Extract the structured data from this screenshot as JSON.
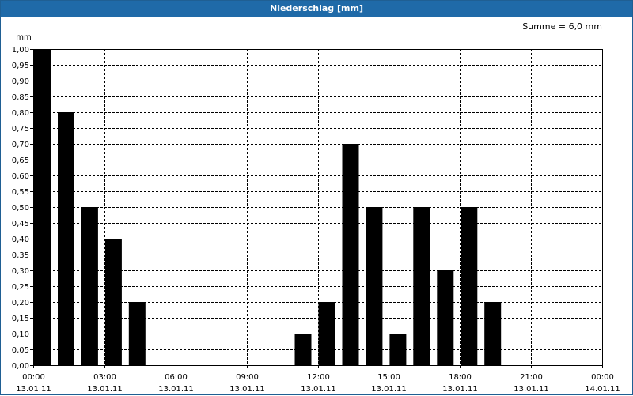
{
  "window": {
    "title": "Niederschlag [mm]"
  },
  "summary": {
    "text": "Summe = 6,0 mm"
  },
  "chart_data": {
    "type": "bar",
    "title": "Niederschlag [mm]",
    "ylabel": "mm",
    "xlabel": "",
    "ylim": [
      0,
      1.0
    ],
    "yticks": [
      "0,00",
      "0,05",
      "0,10",
      "0,15",
      "0,20",
      "0,25",
      "0,30",
      "0,35",
      "0,40",
      "0,45",
      "0,50",
      "0,55",
      "0,60",
      "0,65",
      "0,70",
      "0,75",
      "0,80",
      "0,85",
      "0,90",
      "0,95",
      "1,00"
    ],
    "xlim_hours": [
      0,
      24
    ],
    "xticks": [
      {
        "time": "00:00",
        "date": "13.01.11"
      },
      {
        "time": "03:00",
        "date": "13.01.11"
      },
      {
        "time": "06:00",
        "date": "13.01.11"
      },
      {
        "time": "09:00",
        "date": "13.01.11"
      },
      {
        "time": "12:00",
        "date": "13.01.11"
      },
      {
        "time": "15:00",
        "date": "13.01.11"
      },
      {
        "time": "18:00",
        "date": "13.01.11"
      },
      {
        "time": "21:00",
        "date": "13.01.11"
      },
      {
        "time": "00:00",
        "date": "14.01.11"
      }
    ],
    "categories": [
      "00:00",
      "01:00",
      "02:00",
      "03:00",
      "04:00",
      "05:00",
      "06:00",
      "07:00",
      "08:00",
      "09:00",
      "10:00",
      "11:00",
      "12:00",
      "13:00",
      "14:00",
      "15:00",
      "16:00",
      "17:00",
      "18:00",
      "19:00",
      "20:00",
      "21:00",
      "22:00",
      "23:00"
    ],
    "values": [
      1.0,
      0.8,
      0.5,
      0.4,
      0.2,
      0,
      0,
      0,
      0,
      0,
      0,
      0.1,
      0.2,
      0.7,
      0.5,
      0.1,
      0.5,
      0.3,
      0.5,
      0.2,
      0,
      0,
      0,
      0
    ],
    "colors": {
      "bar": "#000000",
      "grid": "#000000",
      "title_bg": "#1f6aa8"
    },
    "grid": true
  }
}
